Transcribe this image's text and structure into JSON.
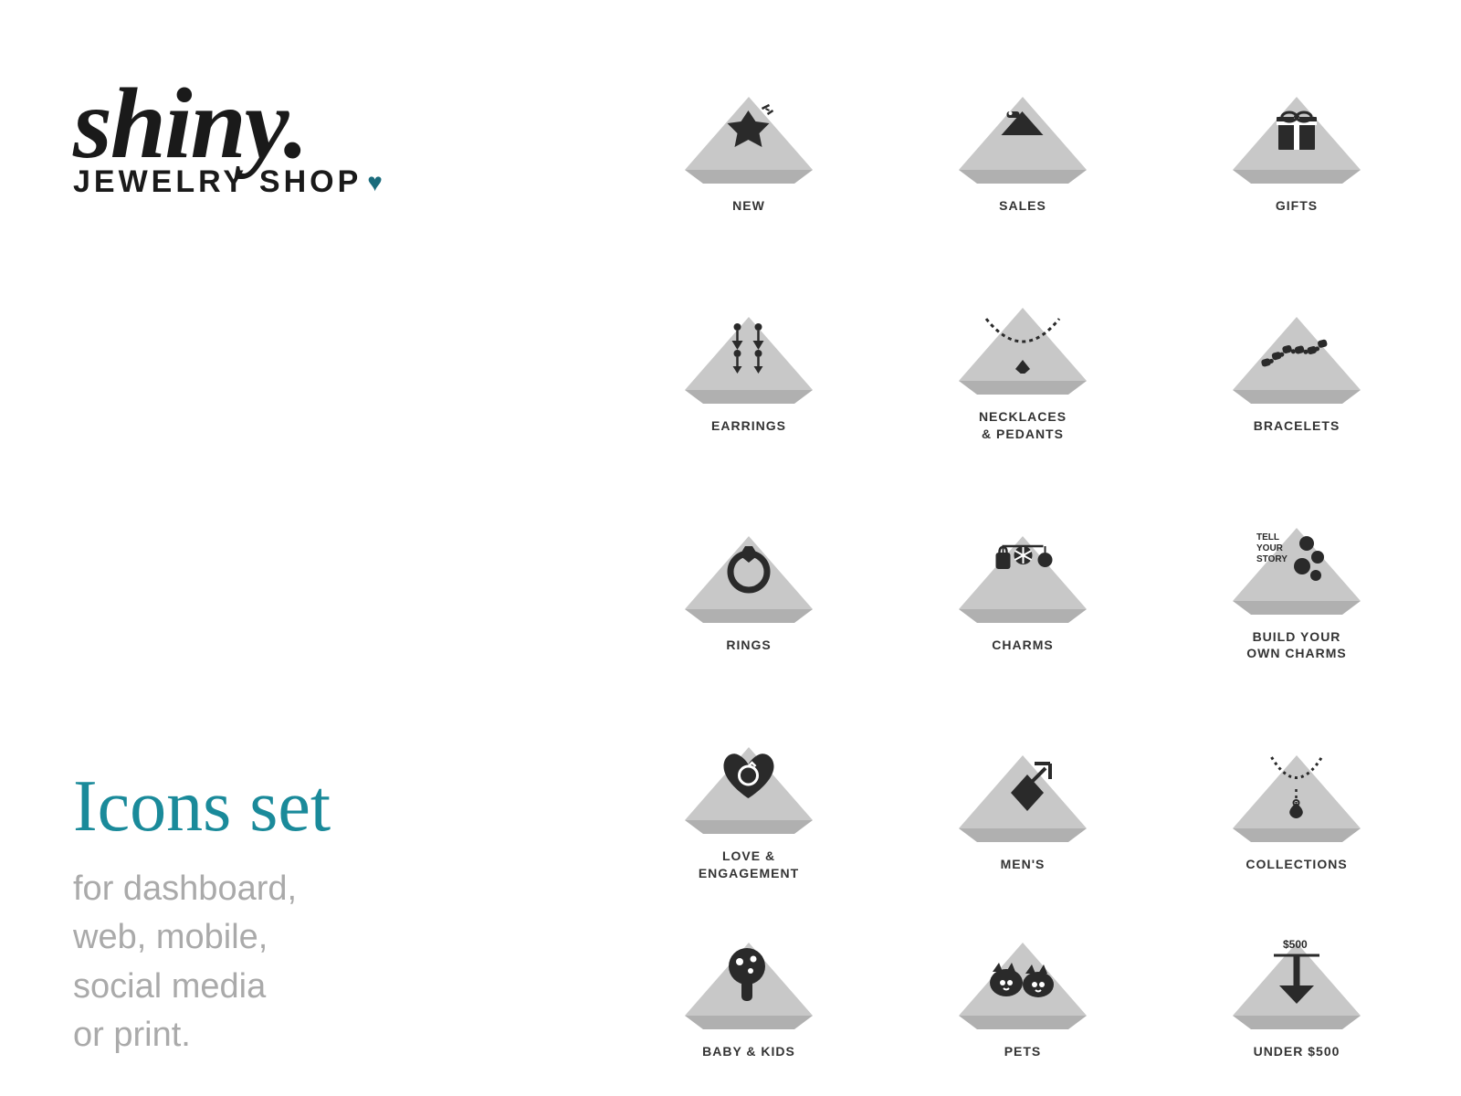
{
  "logo": {
    "brand": "shiny.",
    "subtitle": "JEWELRY SHOP",
    "heart": "♥"
  },
  "icons_set": {
    "title": "Icons set",
    "description": "for dashboard,\nweb, mobile,\nsocial media\nor print."
  },
  "categories": [
    {
      "id": "new",
      "label": "NEW",
      "icon_type": "diamond-sparkle"
    },
    {
      "id": "sales",
      "label": "SALES",
      "icon_type": "tag"
    },
    {
      "id": "gifts",
      "label": "GIFTS",
      "icon_type": "gift"
    },
    {
      "id": "earrings",
      "label": "EARRINGS",
      "icon_type": "earrings"
    },
    {
      "id": "necklaces",
      "label": "NECKLACES\n& PEDANTS",
      "icon_type": "necklace"
    },
    {
      "id": "bracelets",
      "label": "BRACELETS",
      "icon_type": "bracelet"
    },
    {
      "id": "rings",
      "label": "RINGS",
      "icon_type": "ring"
    },
    {
      "id": "charms",
      "label": "CHARMS",
      "icon_type": "charms"
    },
    {
      "id": "build-charms",
      "label": "BUILD YOUR\nOWN CHARMS",
      "icon_type": "build-charms",
      "sub_label": "TELL\nYOUR\nSTORY"
    },
    {
      "id": "love",
      "label": "LOVE &\nENGAGEMENT",
      "icon_type": "heart-ring"
    },
    {
      "id": "mens",
      "label": "MEN'S",
      "icon_type": "diamond-arrow"
    },
    {
      "id": "collections",
      "label": "COLLECTIONS",
      "icon_type": "necklace-collection"
    },
    {
      "id": "baby",
      "label": "BABY & KIDS",
      "icon_type": "rattle"
    },
    {
      "id": "pets",
      "label": "PETS",
      "icon_type": "pets"
    },
    {
      "id": "under500",
      "label": "UNDER $500",
      "icon_type": "price-down",
      "price_label": "$500"
    }
  ],
  "colors": {
    "teal": "#1a8a9a",
    "dark": "#2a2a2a",
    "gray_bg": "#c8c8c8",
    "label": "#333333"
  }
}
